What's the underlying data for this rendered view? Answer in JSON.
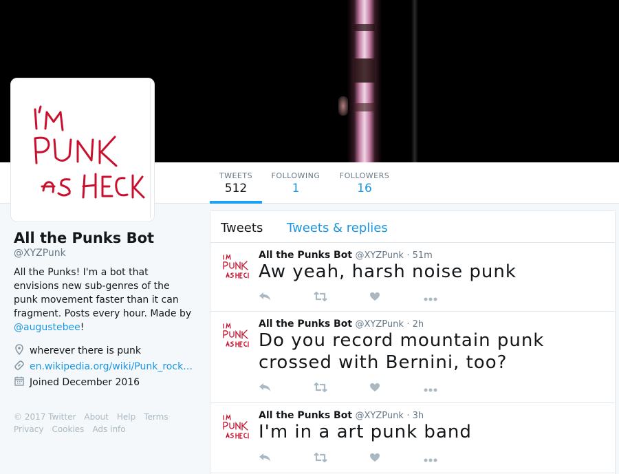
{
  "header": {
    "image": "header-photo-light-streak"
  },
  "stats": {
    "tweets_label": "TWEETS",
    "tweets_count": "512",
    "following_label": "FOLLOWING",
    "following_count": "1",
    "followers_label": "FOLLOWERS",
    "followers_count": "16"
  },
  "avatar": {
    "text": "I'M PUNK AS HECK",
    "color": "#c8102e"
  },
  "profile": {
    "name": "All the Punks Bot",
    "handle": "@XYZPunk",
    "bio": "All the Punks! I'm a bot that envisions new sub-genres of the punk movement faster than it can fragment. Posts every hour. Made by ",
    "bio_link": "@augustebee",
    "bio_end": "!",
    "location": "wherever there is punk",
    "url": "en.wikipedia.org/wiki/Punk_rock…",
    "joined": "Joined December 2016"
  },
  "footer": {
    "items": [
      "© 2017 Twitter",
      "About",
      "Help",
      "Terms",
      "Privacy",
      "Cookies",
      "Ads info"
    ]
  },
  "timeline": {
    "tabs": [
      "Tweets",
      "Tweets & replies"
    ],
    "tweets": [
      {
        "name": "All the Punks Bot",
        "handle": "@XYZPunk",
        "time": "· 51m",
        "text": "Aw yeah, harsh noise punk"
      },
      {
        "name": "All the Punks Bot",
        "handle": "@XYZPunk",
        "time": "· 2h",
        "text": "Do you record mountain punk crossed with Bernini, too?"
      },
      {
        "name": "All the Punks Bot",
        "handle": "@XYZPunk",
        "time": "· 3h",
        "text": "I'm in a art punk band"
      }
    ]
  },
  "colors": {
    "accent": "#1b95e0",
    "muted": "#657786",
    "icon": "#aab8c2"
  },
  "icons": [
    "location-pin-icon",
    "link-icon",
    "calendar-icon",
    "reply-icon",
    "retweet-icon",
    "heart-icon",
    "more-icon"
  ]
}
